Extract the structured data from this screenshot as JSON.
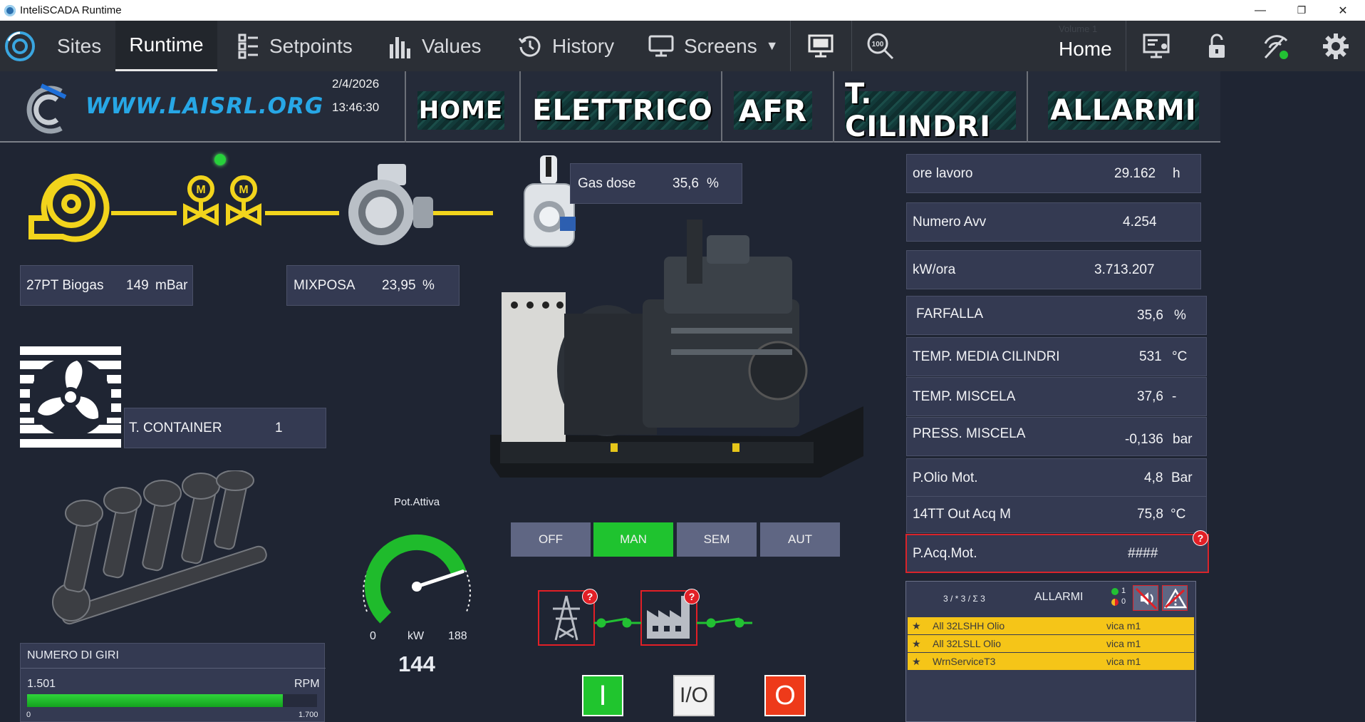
{
  "window": {
    "title": "InteliSCADA Runtime",
    "minimize": "—",
    "restore": "❐",
    "close": "✕"
  },
  "toolbar": {
    "sites": "Sites",
    "runtime": "Runtime",
    "setpoints": "Setpoints",
    "values": "Values",
    "history": "History",
    "screens": "Screens",
    "screens_arrow": "▼",
    "home_hint": "Volume 1",
    "home": "Home"
  },
  "header": {
    "logo_text": "WWW.LAISRL.ORG",
    "date": "2/4/2026",
    "time": "13:46:30",
    "nav": [
      "HOME",
      "ELETTRICO",
      "AFR",
      "T. CILINDRI",
      "ALLARMI"
    ]
  },
  "left": {
    "gas_dose": {
      "label": "Gas dose",
      "value": "35,6",
      "unit": "%"
    },
    "biogas": {
      "label": "27PT Biogas",
      "value": "149",
      "unit": "mBar"
    },
    "mixposa": {
      "label": "MIXPOSA",
      "value": "23,95",
      "unit": "%"
    },
    "container": {
      "label": "T. CONTAINER",
      "value": "1"
    },
    "rpm": {
      "title": "NUMERO DI GIRI",
      "value": "1.501",
      "unit": "RPM",
      "min": "0",
      "max": "1.700",
      "fraction": 0.883
    }
  },
  "gauge": {
    "title": "Pot.Attiva",
    "min": "0",
    "unit": "kW",
    "max": "188",
    "value": "144",
    "fraction": 0.766
  },
  "modes": {
    "off": "OFF",
    "man": "MAN",
    "sem": "SEM",
    "aut": "AUT",
    "active": "MAN"
  },
  "badges": {
    "q": "?"
  },
  "breaker_buttons": {
    "close": "I",
    "toggle": "I/O",
    "open": "O"
  },
  "right": [
    {
      "label": "ore lavoro",
      "value": "29.162",
      "unit": "h"
    },
    {
      "label": "Numero Avv",
      "value": "4.254",
      "unit": ""
    },
    {
      "label": "kW/ora",
      "value": "3.713.207",
      "unit": ""
    },
    {
      "label": "FARFALLA",
      "value": "35,6",
      "unit": "%"
    },
    {
      "label": "TEMP. MEDIA CILINDRI",
      "value": "531",
      "unit": "°C"
    },
    {
      "label": "TEMP. MISCELA",
      "value": "37,6",
      "unit": "-"
    },
    {
      "label": "PRESS. MISCELA",
      "value": "-0,136",
      "unit": "bar"
    },
    {
      "label": "P.Olio Mot.",
      "value": "4,8",
      "unit": "Bar"
    },
    {
      "label": "14TT Out Acq M",
      "value": "75,8",
      "unit": "°C"
    },
    {
      "label": "P.Acq.Mot.",
      "value": "####",
      "unit": ""
    }
  ],
  "alarms": {
    "counter": "3 / * 3 / Σ 3",
    "title": "ALLARMI",
    "count_active": "1",
    "count_unack": "0",
    "rows": [
      {
        "star": "★",
        "name": "All 32LSHH Olio",
        "source": "vica m1"
      },
      {
        "star": "★",
        "name": "All 32LSLL Olio",
        "source": "vica m1"
      },
      {
        "star": "★",
        "name": "WrnServiceT3",
        "source": "vica m1"
      }
    ]
  },
  "colors": {
    "accent_green": "#22c133",
    "alarm_yellow": "#f5c518",
    "alarm_red": "#e21f26",
    "pipe_yellow": "#f2d41c"
  }
}
